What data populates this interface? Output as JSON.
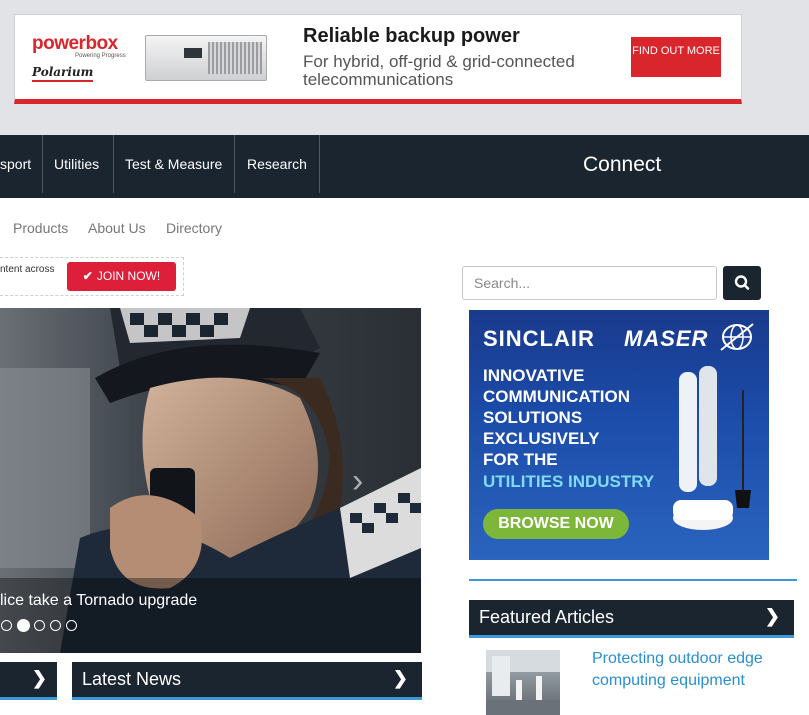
{
  "banner": {
    "brand": "powerbox",
    "brand_tagline": "Powering Progress",
    "partner": "Polarium",
    "title": "Reliable backup power",
    "subtitle": "For hybrid, off-grid & grid-connected telecommunications",
    "cta": "FIND OUT MORE"
  },
  "nav": {
    "items": [
      {
        "label": "sport"
      },
      {
        "label": "Utilities"
      },
      {
        "label": "Test & Measure"
      },
      {
        "label": "Research"
      }
    ],
    "connect_label": "Connect",
    "social": [
      "twitter-icon",
      "facebook-icon",
      "linkedin-icon"
    ]
  },
  "subnav": {
    "items": [
      {
        "label": "Products"
      },
      {
        "label": "About Us"
      },
      {
        "label": "Directory"
      }
    ]
  },
  "promo": {
    "text": "ntent across",
    "join_label": "JOIN NOW!"
  },
  "hero": {
    "caption": "lice take a Tornado upgrade",
    "slide_count": 5,
    "active_slide": 2
  },
  "sections": {
    "latest_news": "Latest News",
    "featured_articles": "Featured Articles"
  },
  "search": {
    "placeholder": "Search..."
  },
  "ad2": {
    "brand_left": "SINCLAIR",
    "brand_right": "MASER",
    "lines": [
      "INNOVATIVE",
      "COMMUNICATION",
      "SOLUTIONS",
      "EXCLUSIVELY",
      "FOR THE"
    ],
    "highlight": "UTILITIES INDUSTRY",
    "cta": "BROWSE NOW"
  },
  "featured": {
    "title": "Protecting outdoor edge computing equipment"
  },
  "colors": {
    "nav_bg": "#1b2530",
    "accent_blue": "#3a9ad9",
    "join_red": "#dd1f3a",
    "brand_red": "#d9262c",
    "link_blue": "#2a8fd0"
  }
}
